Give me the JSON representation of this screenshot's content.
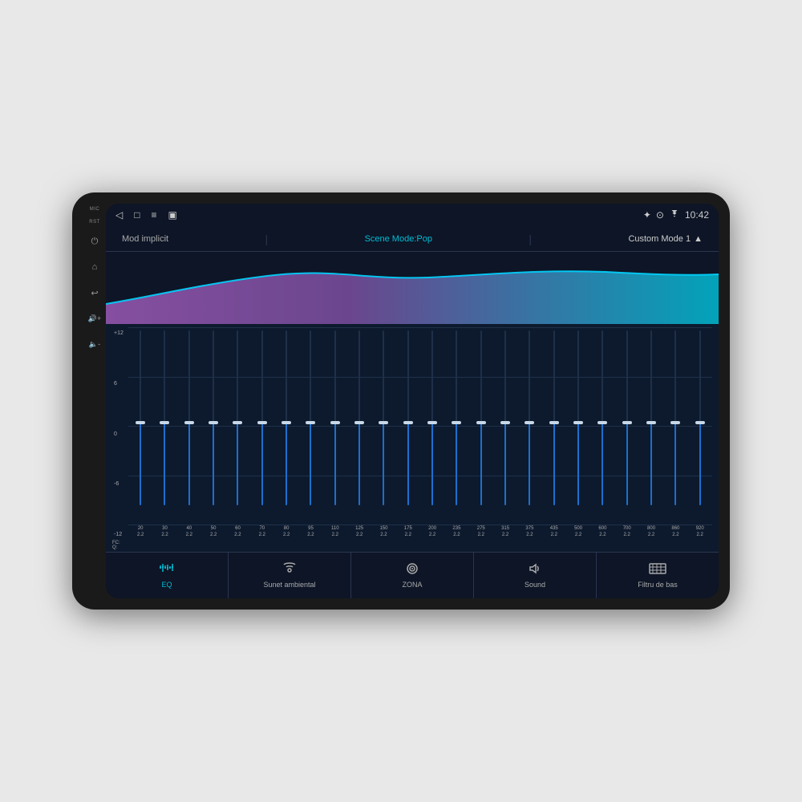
{
  "device": {
    "status_bar": {
      "left_icons": [
        "back-arrow",
        "home-square",
        "menu-lines",
        "bookmark"
      ],
      "right_icons": [
        "bluetooth",
        "location",
        "wifi"
      ],
      "time": "10:42"
    },
    "mode_bar": {
      "mode_implicit": "Mod implicit",
      "scene_mode": "Scene Mode:Pop",
      "custom_mode": "Custom Mode 1"
    },
    "eq": {
      "scale_max": "+12",
      "scale_mid_high": "6",
      "scale_mid": "0",
      "scale_mid_low": "-6",
      "scale_min": "-12",
      "fc_label": "FC:",
      "q_label": "Q:",
      "bands": [
        {
          "freq": "20",
          "q": "2.2",
          "thumb_pct": 52
        },
        {
          "freq": "30",
          "q": "2.2",
          "thumb_pct": 52
        },
        {
          "freq": "40",
          "q": "2.2",
          "thumb_pct": 52
        },
        {
          "freq": "50",
          "q": "2.2",
          "thumb_pct": 52
        },
        {
          "freq": "60",
          "q": "2.2",
          "thumb_pct": 52
        },
        {
          "freq": "70",
          "q": "2.2",
          "thumb_pct": 52
        },
        {
          "freq": "80",
          "q": "2.2",
          "thumb_pct": 52
        },
        {
          "freq": "95",
          "q": "2.2",
          "thumb_pct": 52
        },
        {
          "freq": "110",
          "q": "2.2",
          "thumb_pct": 52
        },
        {
          "freq": "125",
          "q": "2.2",
          "thumb_pct": 52
        },
        {
          "freq": "150",
          "q": "2.2",
          "thumb_pct": 52
        },
        {
          "freq": "175",
          "q": "2.2",
          "thumb_pct": 52
        },
        {
          "freq": "200",
          "q": "2.2",
          "thumb_pct": 52
        },
        {
          "freq": "235",
          "q": "2.2",
          "thumb_pct": 52
        },
        {
          "freq": "275",
          "q": "2.2",
          "thumb_pct": 52
        },
        {
          "freq": "315",
          "q": "2.2",
          "thumb_pct": 52
        },
        {
          "freq": "375",
          "q": "2.2",
          "thumb_pct": 52
        },
        {
          "freq": "435",
          "q": "2.2",
          "thumb_pct": 52
        },
        {
          "freq": "500",
          "q": "2.2",
          "thumb_pct": 52
        },
        {
          "freq": "600",
          "q": "2.2",
          "thumb_pct": 52
        },
        {
          "freq": "700",
          "q": "2.2",
          "thumb_pct": 52
        },
        {
          "freq": "800",
          "q": "2.2",
          "thumb_pct": 52
        },
        {
          "freq": "860",
          "q": "2.2",
          "thumb_pct": 52
        },
        {
          "freq": "920",
          "q": "2.2",
          "thumb_pct": 52
        }
      ]
    },
    "bottom_nav": [
      {
        "id": "eq",
        "label": "EQ",
        "icon": "sliders",
        "active": true
      },
      {
        "id": "ambient",
        "label": "Sunet ambiental",
        "icon": "radio-waves",
        "active": false
      },
      {
        "id": "zone",
        "label": "ZONA",
        "icon": "target",
        "active": false
      },
      {
        "id": "sound",
        "label": "Sound",
        "icon": "speaker",
        "active": false
      },
      {
        "id": "bass",
        "label": "Filtru de bas",
        "icon": "filter",
        "active": false
      }
    ],
    "side_controls": [
      {
        "id": "mic",
        "label": "MIC"
      },
      {
        "id": "rst",
        "label": "RST"
      },
      {
        "id": "power"
      },
      {
        "id": "home"
      },
      {
        "id": "back"
      },
      {
        "id": "vol-up"
      },
      {
        "id": "vol-down"
      }
    ]
  }
}
